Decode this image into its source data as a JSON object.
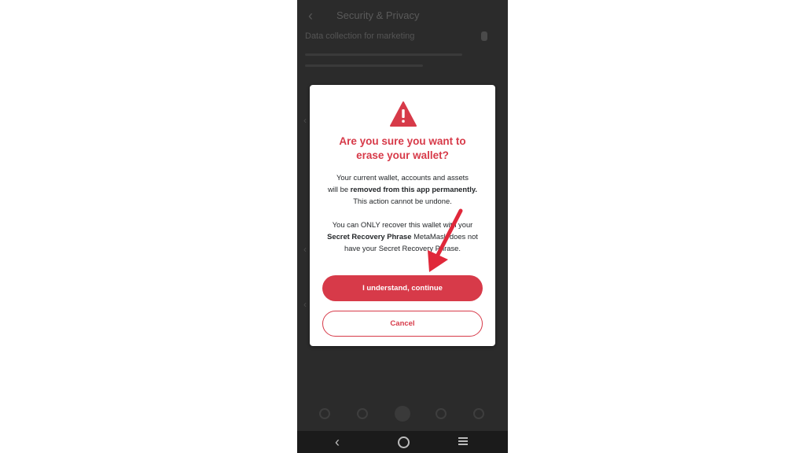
{
  "background": {
    "header_title": "Security & Privacy",
    "setting_label": "Data collection for marketing"
  },
  "dialog": {
    "icon": "warning-triangle-icon",
    "title_line1": "Are you sure you want to",
    "title_line2": "erase your wallet?",
    "p1_a": "Your current wallet, accounts and assets",
    "p1_b": "will be ",
    "p1_bold": "removed from this app permanently.",
    "p1_c": "This action cannot be undone.",
    "p2_a": "You can ONLY recover this wallet with your",
    "p2_bold": "Secret Recovery Phrase",
    "p2_b": " MetaMask does not",
    "p2_c": "have your Secret Recovery Phrase.",
    "continue_label": "I understand, continue",
    "cancel_label": "Cancel"
  },
  "colors": {
    "accent": "#d73a49",
    "dialog_bg": "#ffffff",
    "overlay": "#2b2b2b"
  }
}
